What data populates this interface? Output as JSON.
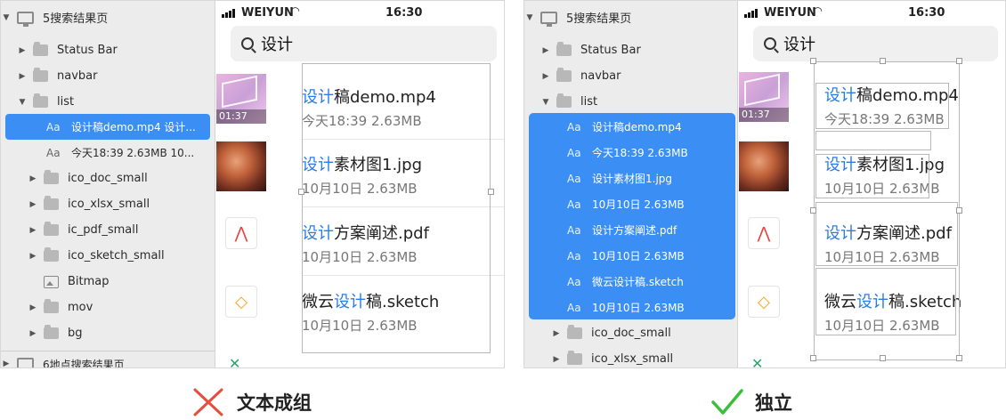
{
  "colors": {
    "selection": "#3b8ff4",
    "highlight": "#2a7ce8",
    "cross": "#e74c3c",
    "check": "#3bbf3b"
  },
  "left_panel": {
    "layers": {
      "artboard": "5搜索结果页",
      "items": [
        {
          "type": "folder",
          "label": "Status Bar",
          "expand": "closed"
        },
        {
          "type": "folder",
          "label": "navbar",
          "expand": "closed"
        },
        {
          "type": "folder",
          "label": "list",
          "expand": "open"
        },
        {
          "type": "text",
          "label": "设计稿demo.mp4 设计..."
        },
        {
          "type": "text",
          "label": "今天18:39 2.63MB 10..."
        },
        {
          "type": "folder",
          "label": "ico_doc_small",
          "expand": "closed"
        },
        {
          "type": "folder",
          "label": "ico_xlsx_small",
          "expand": "closed"
        },
        {
          "type": "folder",
          "label": "ic_pdf_small",
          "expand": "closed"
        },
        {
          "type": "folder",
          "label": "ico_sketch_small",
          "expand": "closed"
        },
        {
          "type": "bitmap",
          "label": "Bitmap"
        },
        {
          "type": "folder",
          "label": "mov",
          "expand": "closed"
        },
        {
          "type": "folder",
          "label": "bg",
          "expand": "closed"
        }
      ],
      "next_artboard": "6地点搜索结果页"
    }
  },
  "right_panel": {
    "layers": {
      "artboard": "5搜索结果页",
      "items": [
        {
          "type": "folder",
          "label": "Status Bar",
          "expand": "closed"
        },
        {
          "type": "folder",
          "label": "navbar",
          "expand": "closed"
        },
        {
          "type": "folder",
          "label": "list",
          "expand": "open"
        }
      ],
      "selected_texts": [
        "设计稿demo.mp4",
        "今天18:39 2.63MB",
        "设计素材图1.jpg",
        "10月10日 2.63MB",
        "设计方案阐述.pdf",
        "10月10日 2.63MB",
        "微云设计稿.sketch",
        "10月10日 2.63MB"
      ],
      "after_items": [
        {
          "type": "folder",
          "label": "ico_doc_small",
          "expand": "closed"
        },
        {
          "type": "folder",
          "label": "ico_xlsx_small",
          "expand": "closed"
        }
      ]
    }
  },
  "phone": {
    "status_bar": {
      "carrier": "WEIYUN",
      "wifi_icon": "wifi-icon",
      "time": "16:30"
    },
    "search": {
      "query": "设计"
    },
    "files": [
      {
        "thumb": "video",
        "duration": "01:37",
        "name_hl": "设计",
        "name_rest": "稿demo.mp4",
        "name_pre": "",
        "meta": "今天18:39 2.63MB"
      },
      {
        "thumb": "photo",
        "name_hl": "设计",
        "name_rest": "素材图1.jpg",
        "name_pre": "",
        "meta": "10月10日 2.63MB"
      },
      {
        "thumb": "pdf",
        "icon": "pdf-icon",
        "name_hl": "设计",
        "name_rest": "方案阐述.pdf",
        "name_pre": "",
        "meta": "10月10日 2.63MB"
      },
      {
        "thumb": "sketch",
        "icon": "sketch-icon",
        "name_hl": "设计",
        "name_rest": "稿.sketch",
        "name_pre": "微云",
        "meta": "10月10日 2.63MB"
      }
    ]
  },
  "captions": {
    "wrong": "文本成组",
    "right": "独立"
  }
}
